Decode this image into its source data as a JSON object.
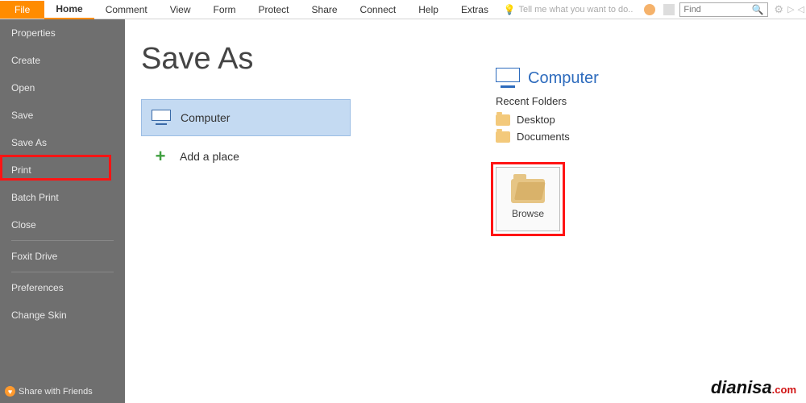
{
  "tabs": {
    "file": "File",
    "home": "Home",
    "comment": "Comment",
    "view": "View",
    "form": "Form",
    "protect": "Protect",
    "share": "Share",
    "connect": "Connect",
    "help": "Help",
    "extras": "Extras"
  },
  "tellme": "Tell me what you want to do..",
  "search": {
    "placeholder": "Find"
  },
  "sidebar": {
    "properties": "Properties",
    "create": "Create",
    "open": "Open",
    "save": "Save",
    "saveas": "Save As",
    "print": "Print",
    "batchprint": "Batch Print",
    "close": "Close",
    "foxitdrive": "Foxit Drive",
    "preferences": "Preferences",
    "changeskin": "Change Skin",
    "sharefriends": "Share with Friends"
  },
  "page": {
    "title": "Save As"
  },
  "locations": {
    "computer": "Computer",
    "addplace": "Add a place"
  },
  "panel": {
    "computer": "Computer",
    "recent_label": "Recent Folders",
    "folders": [
      "Desktop",
      "Documents"
    ],
    "browse": "Browse"
  },
  "watermark": {
    "text": "dianisa",
    "suffix": ".com"
  }
}
